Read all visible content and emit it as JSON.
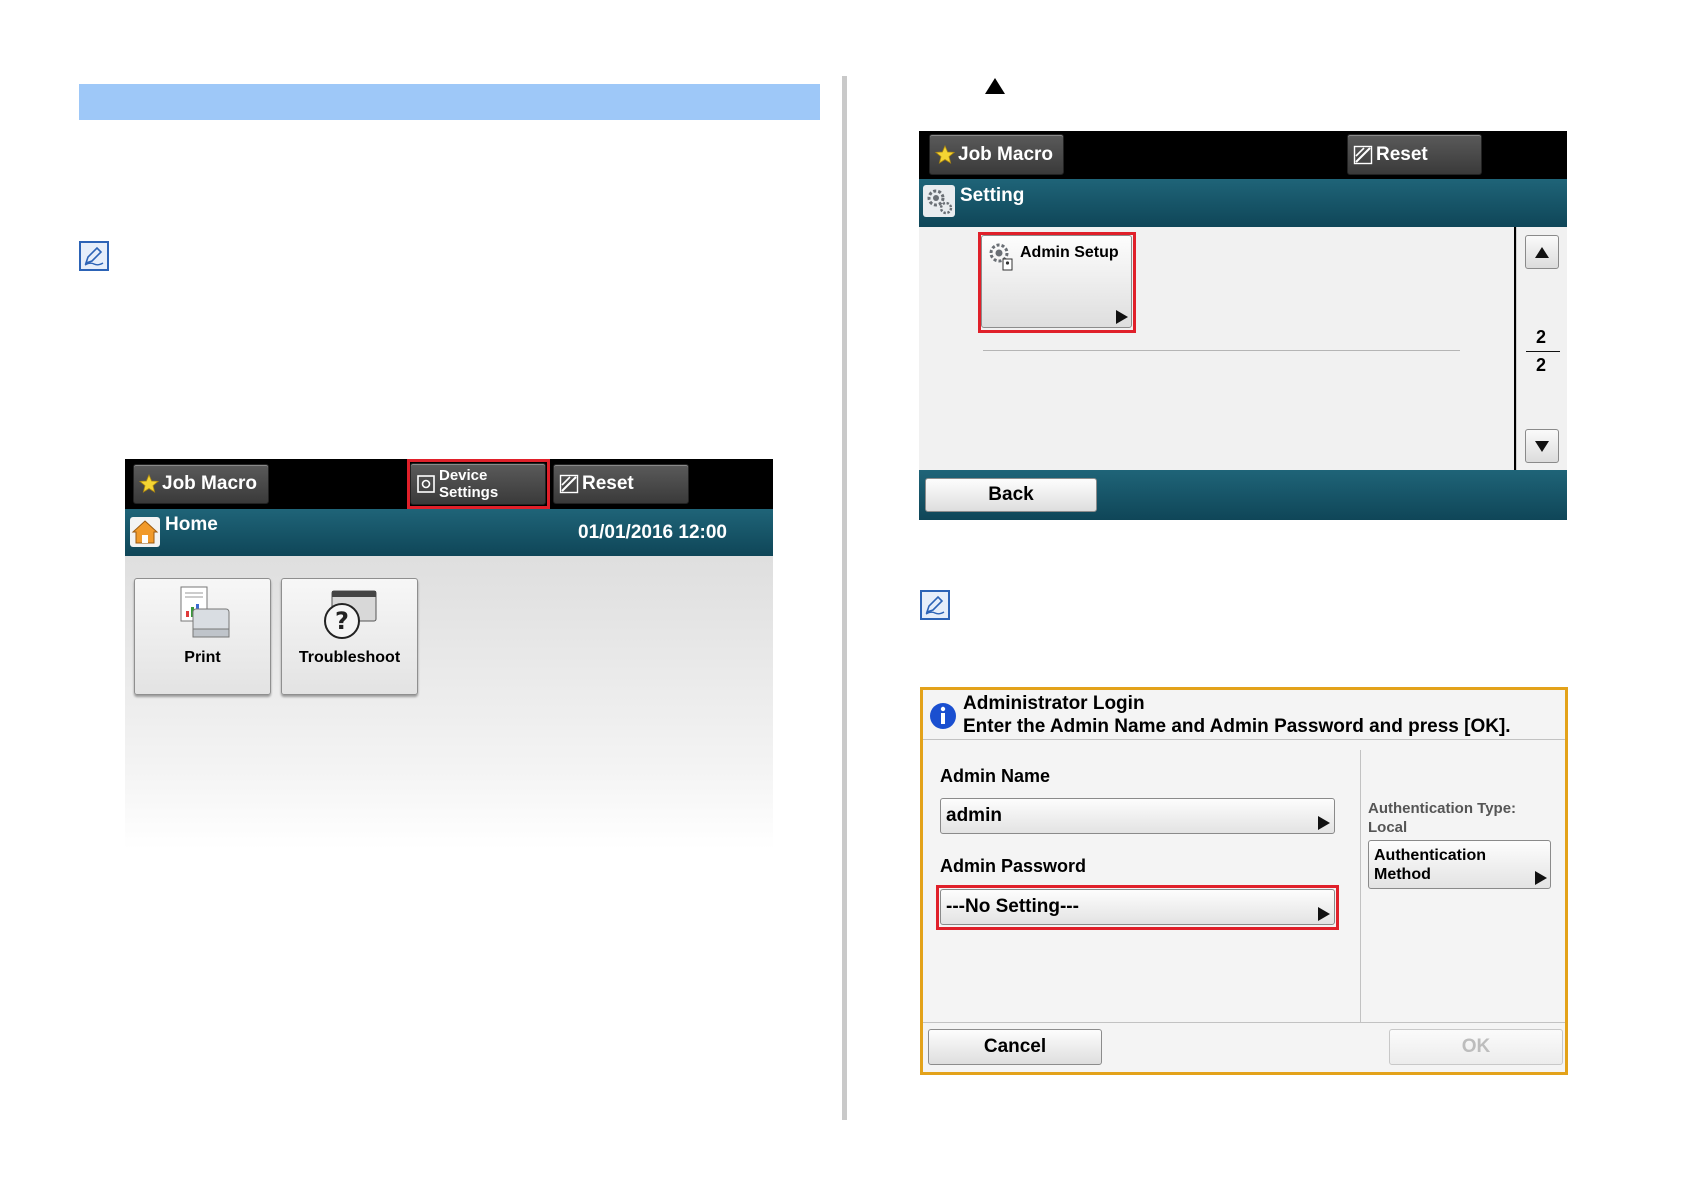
{
  "home_screen": {
    "job_macro_label": "Job Macro",
    "device_settings_line1": "Device",
    "device_settings_line2": "Settings",
    "reset_label": "Reset",
    "title": "Home",
    "datetime": "01/01/2016 12:00",
    "tiles": [
      {
        "label": "Print"
      },
      {
        "label": "Troubleshoot"
      }
    ]
  },
  "setting_screen": {
    "job_macro_label": "Job Macro",
    "reset_label": "Reset",
    "title": "Setting",
    "item_label": "Admin Setup",
    "page_current": "2",
    "page_total": "2",
    "back_label": "Back"
  },
  "login_dialog": {
    "title": "Administrator Login",
    "message": "Enter the Admin Name and Admin Password and press [OK].",
    "admin_name_label": "Admin Name",
    "admin_name_value": "admin",
    "admin_password_label": "Admin Password",
    "admin_password_value": "---No Setting---",
    "auth_type_line1": "Authentication Type:",
    "auth_type_line2": "Local",
    "auth_method_line1": "Authentication",
    "auth_method_line2": "Method",
    "cancel_label": "Cancel",
    "ok_label": "OK"
  },
  "colors": {
    "header_bar": "#9ec8f8",
    "highlight": "#e0202a",
    "dialog_border": "#e3a21a",
    "panel_teal": "#0f4658"
  }
}
